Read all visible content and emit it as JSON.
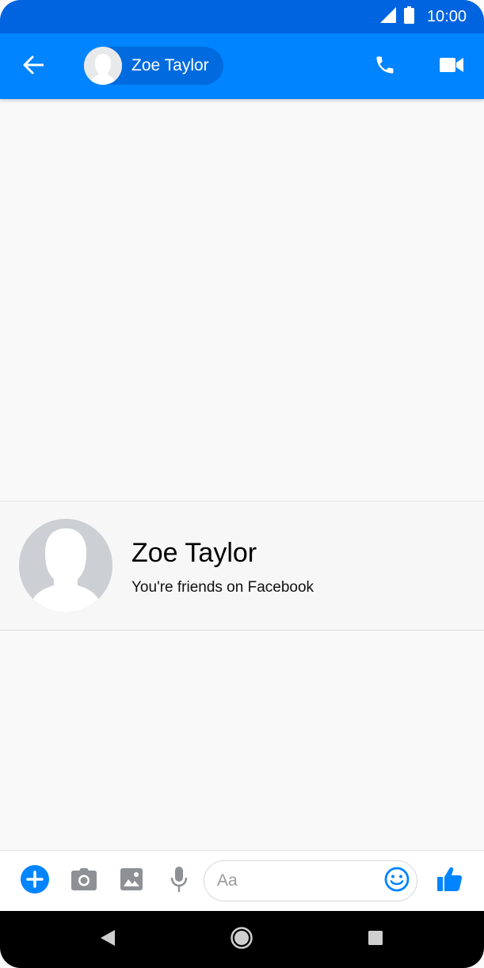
{
  "status_bar": {
    "time": "10:00",
    "icons": [
      "signal-icon",
      "battery-icon"
    ]
  },
  "app_bar": {
    "contact_name": "Zoe Taylor",
    "icons": [
      "back-arrow-icon",
      "phone-icon",
      "video-camera-icon"
    ]
  },
  "profile_card": {
    "name": "Zoe Taylor",
    "subtitle": "You're friends on Facebook"
  },
  "composer": {
    "placeholder": "Aa",
    "icons": [
      "plus-icon",
      "camera-icon",
      "gallery-icon",
      "microphone-icon",
      "emoji-icon",
      "thumbs-up-icon"
    ]
  },
  "nav_bar": {
    "icons": [
      "nav-back-icon",
      "nav-home-icon",
      "nav-recent-icon"
    ]
  },
  "colors": {
    "status_bar": "#0064e0",
    "app_bar": "#0084ff",
    "accent": "#0084ff",
    "background": "#f9f9f9",
    "avatar_placeholder": "#ccd0d5"
  }
}
